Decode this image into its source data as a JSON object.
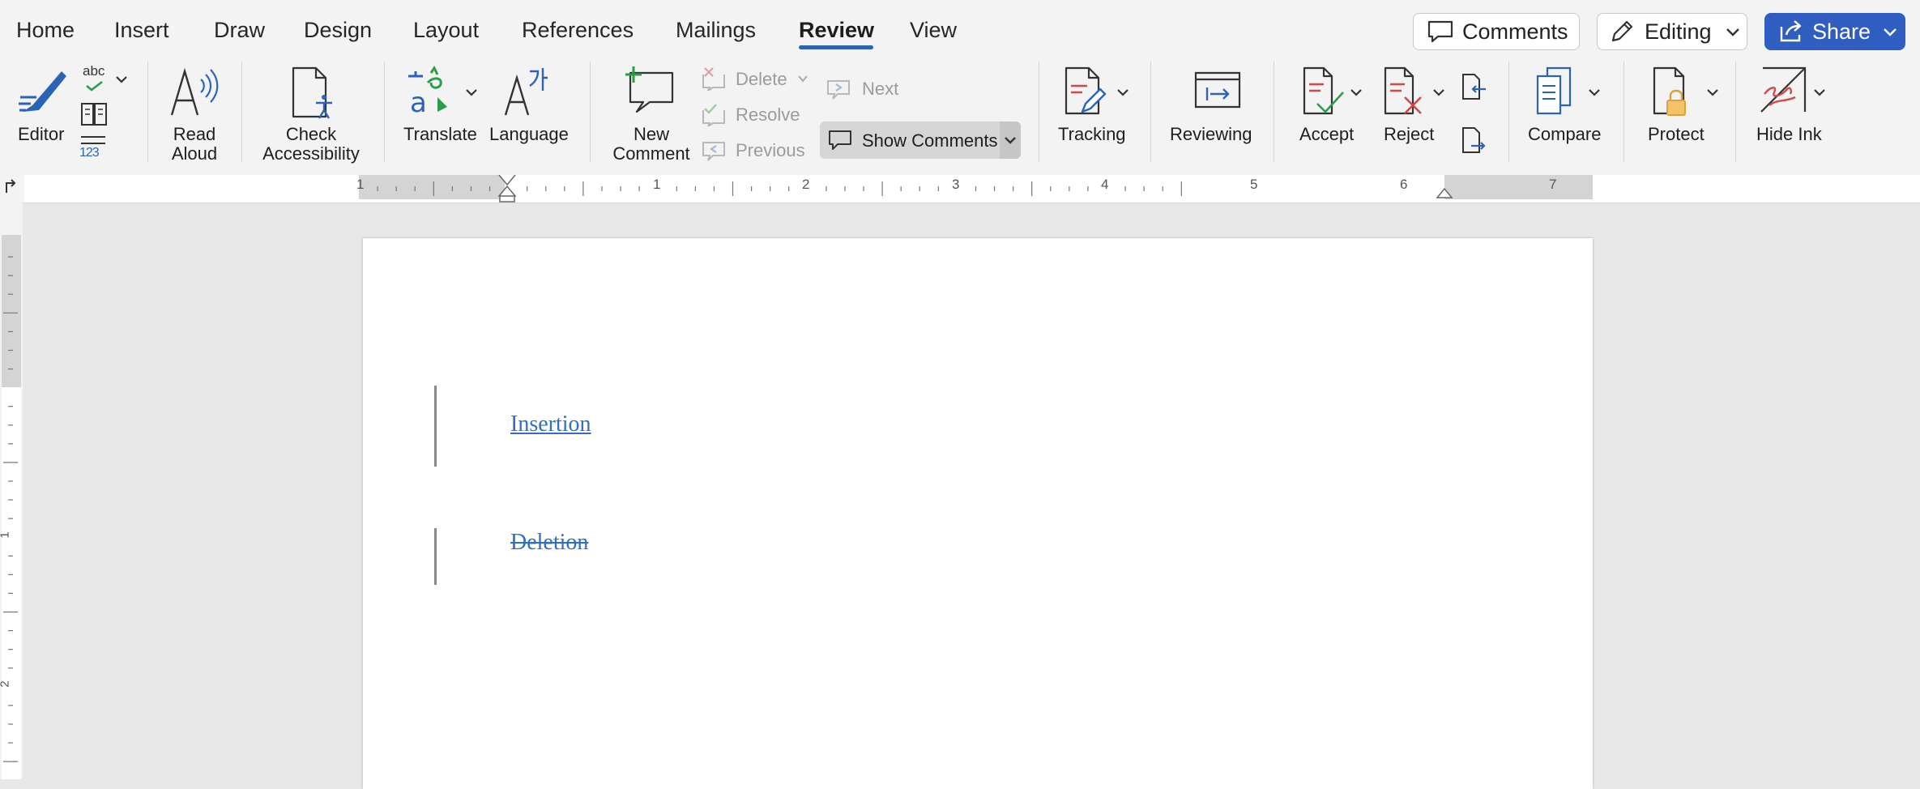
{
  "tabs": [
    {
      "label": "Home",
      "active": false
    },
    {
      "label": "Insert",
      "active": false
    },
    {
      "label": "Draw",
      "active": false
    },
    {
      "label": "Design",
      "active": false
    },
    {
      "label": "Layout",
      "active": false
    },
    {
      "label": "References",
      "active": false
    },
    {
      "label": "Mailings",
      "active": false
    },
    {
      "label": "Review",
      "active": true
    },
    {
      "label": "View",
      "active": false
    }
  ],
  "top_buttons": {
    "comments": "Comments",
    "editing": "Editing",
    "share": "Share"
  },
  "ribbon": {
    "editor": "Editor",
    "spelling_abc": "abc",
    "word_count_num": "123",
    "read_aloud": "Read\nAloud",
    "check_accessibility": "Check\nAccessibility",
    "translate": "Translate",
    "language": "Language",
    "new_comment": "New\nComment",
    "delete": "Delete",
    "resolve": "Resolve",
    "previous": "Previous",
    "next": "Next",
    "show_comments": "Show Comments",
    "tracking": "Tracking",
    "reviewing": "Reviewing",
    "accept": "Accept",
    "reject": "Reject",
    "compare": "Compare",
    "protect": "Protect",
    "hide_ink": "Hide Ink"
  },
  "ruler_numbers": [
    "1",
    "1",
    "2",
    "3",
    "4",
    "5",
    "6",
    "7"
  ],
  "vruler_numbers": [
    "1",
    "2"
  ],
  "document": {
    "line1": "Insertion",
    "line2": "Deletion"
  },
  "colors": {
    "accent": "#2d63b5",
    "share_bg": "#2f5ec0",
    "tracked_change": "#2f6fc5"
  }
}
